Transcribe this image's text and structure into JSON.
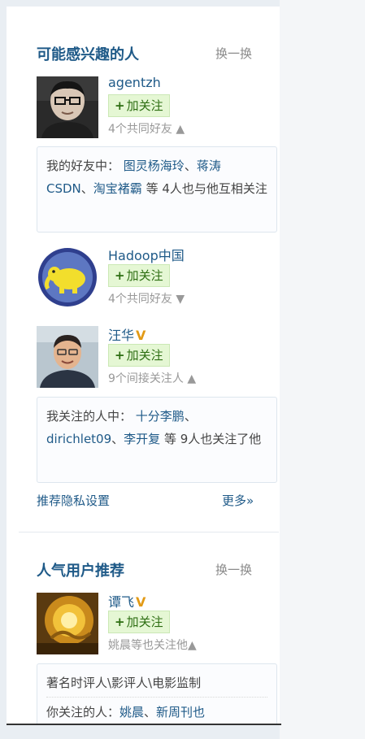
{
  "section1": {
    "title": "可能感兴趣的人",
    "refresh": "换一换",
    "users": [
      {
        "name": "agentzh",
        "follow": "加关注",
        "sub": "4个共同好友 ▲",
        "note": {
          "prefix": "我的好友中：",
          "link1": "图灵杨海玲",
          "s1": "、",
          "link2": "蒋涛CSDN",
          "s2": "、",
          "link3": "淘宝褚霸",
          "suffix": " 等 4人也与他互相关注"
        }
      },
      {
        "name": "Hadoop中国",
        "follow": "加关注",
        "sub": "4个共同好友 ▼"
      },
      {
        "name": "汪华",
        "badge": "V",
        "follow": "加关注",
        "sub": "9个间接关注人 ▲",
        "note": {
          "prefix": "我关注的人中：",
          "link1": "十分李鹏",
          "s1": "、",
          "link2": "dirichlet09",
          "s2": "、",
          "link3": "李开复",
          "suffix": " 等 9人也关注了他"
        }
      }
    ],
    "privacy_link": "推荐隐私设置",
    "more_link": "更多»"
  },
  "section2": {
    "title": "人气用户推荐",
    "refresh": "换一换",
    "user": {
      "name": "谭飞",
      "badge": "V",
      "follow": "加关注",
      "sub": "姚晨等也关注他▲",
      "desc": "著名时评人\\影评人\\电影监制",
      "note": {
        "prefix": "你关注的人：",
        "link1": "姚晨",
        "s1": "、",
        "link2": "新周刊也"
      }
    }
  },
  "colors": {
    "link": "#1f5a88",
    "follow_bg": "#e5f7d4",
    "follow_text": "#2d6e12",
    "badge": "#e29a16"
  }
}
